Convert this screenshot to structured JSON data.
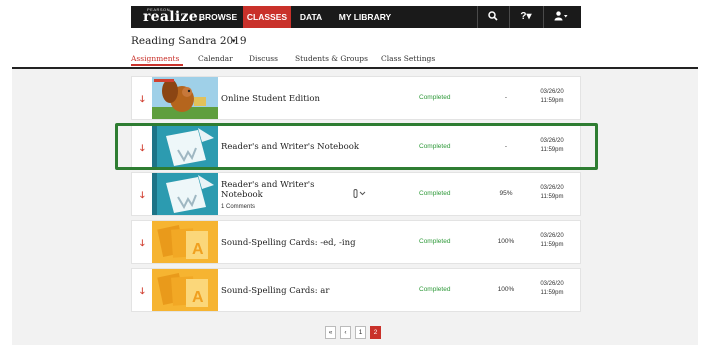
{
  "nav": {
    "brand_small": "PEARSON",
    "brand": "realize.",
    "browse": "BROWSE",
    "classes": "CLASSES",
    "data": "DATA",
    "my_library": "MY LIBRARY",
    "search_icon": "search-icon",
    "help": "?▾",
    "user": "user-icon"
  },
  "class_header": {
    "title": "Reading Sandra 2019",
    "caret": "▾",
    "tabs": [
      "Assignments",
      "Calendar",
      "Discuss",
      "Students & Groups",
      "Class Settings"
    ]
  },
  "assignments": [
    {
      "title": "Online Student Edition",
      "status": "Completed",
      "score": "-",
      "due_date": "03/26/20",
      "due_time": "11:59pm",
      "thumb": "squirrel"
    },
    {
      "title": "Reader's and Writer's Notebook",
      "status": "Completed",
      "score": "-",
      "due_date": "03/26/20",
      "due_time": "11:59pm",
      "thumb": "notebook"
    },
    {
      "title_line1": "Reader's and Writer's",
      "title_line2": "Notebook",
      "comments": "1 Comments",
      "status": "Completed",
      "score": "95%",
      "due_date": "03/26/20",
      "due_time": "11:59pm",
      "thumb": "notebook"
    },
    {
      "title": "Sound-Spelling Cards: -ed, -ing",
      "status": "Completed",
      "score": "100%",
      "due_date": "03/26/20",
      "due_time": "11:59pm",
      "thumb": "cards"
    },
    {
      "title": "Sound-Spelling Cards: ar",
      "status": "Completed",
      "score": "100%",
      "due_date": "03/26/20",
      "due_time": "11:59pm",
      "thumb": "cards"
    }
  ],
  "pagination": {
    "first": "«",
    "prev": "‹",
    "page1": "1",
    "page2": "2",
    "current_page": 2
  },
  "colors": {
    "accent": "#c9312a",
    "completed": "#2f9a3a",
    "highlight": "#2e7d32",
    "nav_bg": "#1a1a1a"
  }
}
